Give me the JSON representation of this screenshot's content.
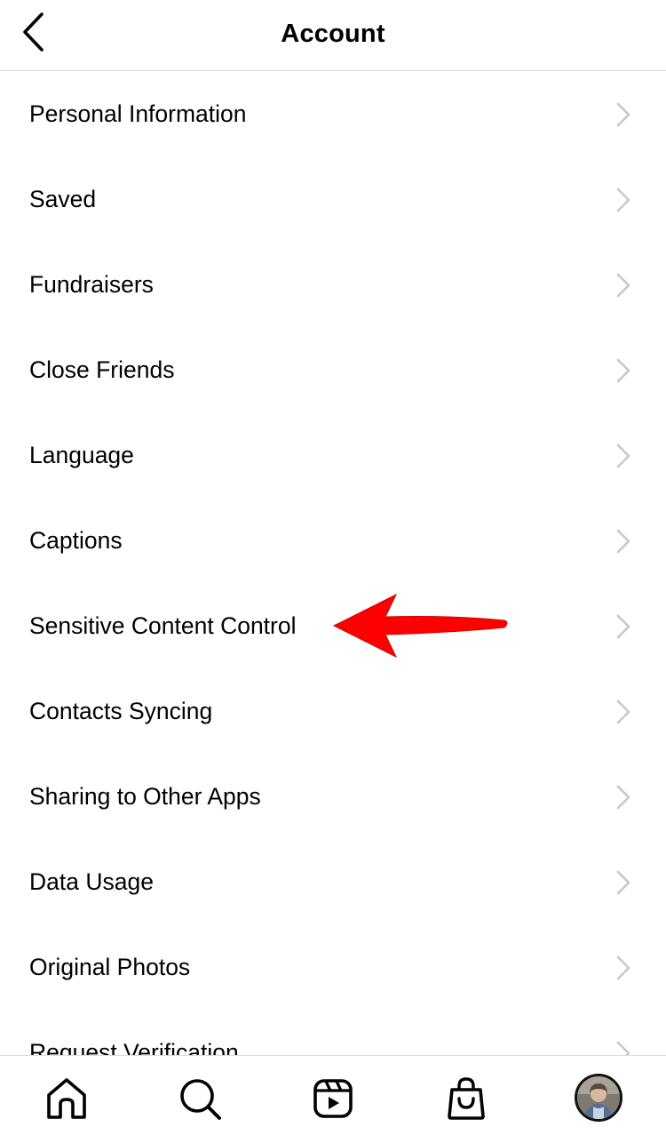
{
  "header": {
    "title": "Account"
  },
  "menu": {
    "items": [
      {
        "label": "Personal Information"
      },
      {
        "label": "Saved"
      },
      {
        "label": "Fundraisers"
      },
      {
        "label": "Close Friends"
      },
      {
        "label": "Language"
      },
      {
        "label": "Captions"
      },
      {
        "label": "Sensitive Content Control"
      },
      {
        "label": "Contacts Syncing"
      },
      {
        "label": "Sharing to Other Apps"
      },
      {
        "label": "Data Usage"
      },
      {
        "label": "Original Photos"
      },
      {
        "label": "Request Verification"
      }
    ]
  },
  "annotation": {
    "arrow_color": "#ff0000",
    "points_to": "Sensitive Content Control"
  },
  "tabbar": {
    "icons": [
      "home-icon",
      "search-icon",
      "reels-icon",
      "shop-icon",
      "profile-avatar"
    ]
  },
  "colors": {
    "text": "#000000",
    "chevron": "#c7c7cc",
    "divider": "#dbdbdb",
    "background": "#ffffff"
  }
}
